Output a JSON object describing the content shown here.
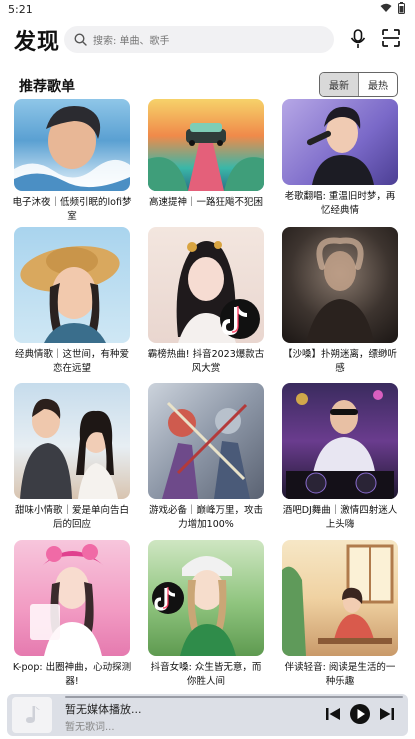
{
  "status": {
    "time": "5:21"
  },
  "header": {
    "title": "发现",
    "search_placeholder": "搜索: 单曲、歌手"
  },
  "section": {
    "title": "推荐歌单",
    "sort_tabs": [
      "最新",
      "最热"
    ],
    "active_sort": "最新"
  },
  "playlists": [
    {
      "title": "电子沐夜｜低频引眠的lofi梦室",
      "cover_icon": "anime-boy-waves-cover"
    },
    {
      "title": "高速提神｜一路狂飚不犯困",
      "cover_icon": "retro-car-road-cover"
    },
    {
      "title": "老歌翻唱: 重温旧时梦，再忆经典情",
      "cover_icon": "singer-microphone-cover"
    },
    {
      "title": "经典情歌｜这世间，有种爱恋在远望",
      "cover_icon": "girl-straw-hat-cover"
    },
    {
      "title": "霸榜热曲! 抖音2023爆款古风大赏",
      "cover_icon": "hanfu-girl-tiktok-cover"
    },
    {
      "title": "【沙嗓】扑朔迷离，缥缈听感",
      "cover_icon": "silhouette-woman-cover"
    },
    {
      "title": "甜味小情歌｜爱是单向告白后的回应",
      "cover_icon": "couple-beach-cover"
    },
    {
      "title": "游戏必备｜巅峰万里，攻击力增加100%",
      "cover_icon": "game-warriors-cover"
    },
    {
      "title": "酒吧DJ舞曲｜激情四射迷人上头嗨",
      "cover_icon": "dj-turntable-cover"
    },
    {
      "title": "K-pop: 出圈神曲，心动探测器!",
      "cover_icon": "kpop-girl-pink-cover"
    },
    {
      "title": "抖音女嗓: 众生皆无意，而你胜人间",
      "cover_icon": "girl-helmet-tiktok-cover"
    },
    {
      "title": "伴读轻音: 阅读是生活的一种乐趣",
      "cover_icon": "reading-girl-cover"
    }
  ],
  "player": {
    "title": "暂无媒体播放...",
    "subtitle": "暂无歌词..."
  }
}
